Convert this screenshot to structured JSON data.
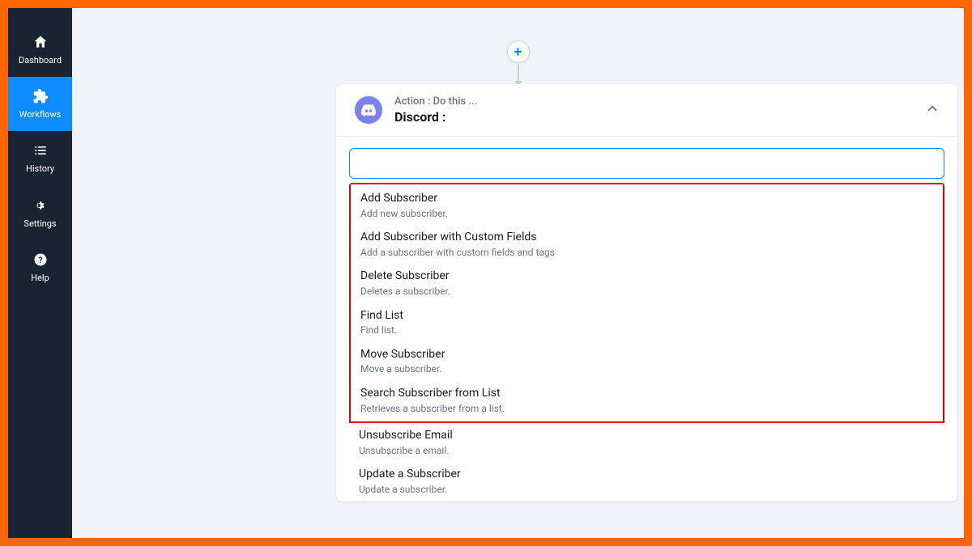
{
  "sidebar": {
    "items": [
      {
        "label": "Dashboard",
        "active": false
      },
      {
        "label": "Workflows",
        "active": true
      },
      {
        "label": "History",
        "active": false
      },
      {
        "label": "Settings",
        "active": false
      },
      {
        "label": "Help",
        "active": false
      }
    ]
  },
  "plus": {
    "symbol": "+"
  },
  "card": {
    "subtitle": "Action : Do this ...",
    "title": "Discord :"
  },
  "search": {
    "value": "",
    "placeholder": ""
  },
  "options": [
    {
      "title": "Add Subscriber",
      "desc": "Add new subscriber."
    },
    {
      "title": "Add Subscriber with Custom Fields",
      "desc": "Add a subscriber with custom fields and tags"
    },
    {
      "title": "Delete Subscriber",
      "desc": "Deletes a subscriber."
    },
    {
      "title": "Find List",
      "desc": "Find list."
    },
    {
      "title": "Move Subscriber",
      "desc": "Move a subscriber."
    },
    {
      "title": "Search Subscriber from List",
      "desc": "Retrieves a subscriber from a list."
    },
    {
      "title": "Unsubscribe Email",
      "desc": "Unsubscribe a email."
    },
    {
      "title": "Update a Subscriber",
      "desc": "Update a subscriber."
    }
  ],
  "highlight_range": [
    0,
    5
  ]
}
